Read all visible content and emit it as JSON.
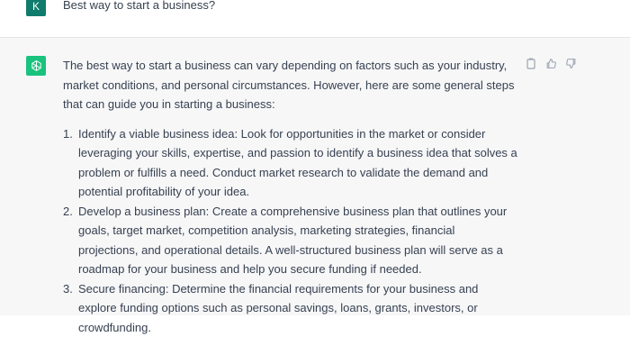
{
  "user_message": {
    "avatar_letter": "K",
    "text": "Best way to start a business?"
  },
  "assistant_message": {
    "intro": "The best way to start a business can vary depending on factors such as your industry, market conditions, and personal circumstances. However, here are some general steps that can guide you in starting a business:",
    "steps": [
      {
        "number": "1.",
        "text": "Identify a viable business idea: Look for opportunities in the market or consider leveraging your skills, expertise, and passion to identify a business idea that solves a problem or fulfills a need. Conduct market research to validate the demand and potential profitability of your idea."
      },
      {
        "number": "2.",
        "text": "Develop a business plan: Create a comprehensive business plan that outlines your goals, target market, competition analysis, marketing strategies, financial projections, and operational details. A well-structured business plan will serve as a roadmap for your business and help you secure funding if needed."
      },
      {
        "number": "3.",
        "text": "Secure financing: Determine the financial requirements for your business and explore funding options such as personal savings, loans, grants, investors, or crowdfunding."
      }
    ],
    "actions": [
      "copy-icon",
      "thumbs-up-icon",
      "thumbs-down-icon"
    ]
  },
  "colors": {
    "user_avatar": "#0f7b6c",
    "assistant_avatar": "#19c37d",
    "assistant_bg": "#f7f7f8",
    "text": "#374151"
  }
}
